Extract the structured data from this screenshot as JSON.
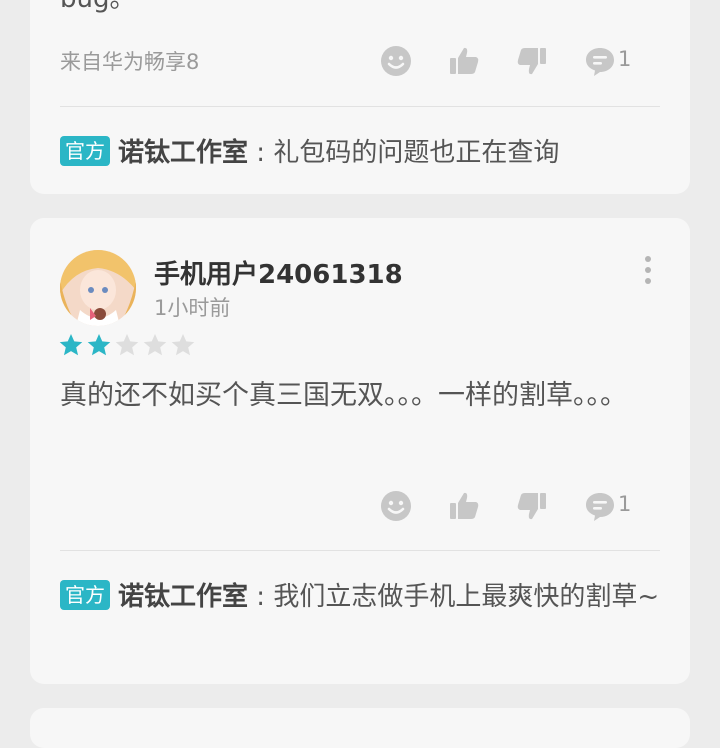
{
  "review1": {
    "content_tail": "bug。",
    "device": "来自华为畅享8",
    "reply_count": "1",
    "reply": {
      "badge": "官方",
      "author": "诺钛工作室",
      "separator": " : ",
      "text": "礼包码的问题也正在查询"
    }
  },
  "review2": {
    "username": "手机用户24061318",
    "time": "1小时前",
    "rating": 2,
    "rating_max": 5,
    "content": "真的还不如买个真三国无双。。。一样的割草。。。",
    "reply_count": "1",
    "reply": {
      "badge": "官方",
      "author": "诺钛工作室",
      "separator": " : ",
      "text": "我们立志做手机上最爽快的割草~"
    }
  },
  "colors": {
    "accent": "#2bb6c6",
    "star_filled": "#2bb6c6",
    "star_empty": "#dedede",
    "icon": "#c7c7c7"
  },
  "icons": [
    "smile-icon",
    "thumbs-up-icon",
    "thumbs-down-icon",
    "comment-icon",
    "more-vertical-icon",
    "star-icon"
  ]
}
